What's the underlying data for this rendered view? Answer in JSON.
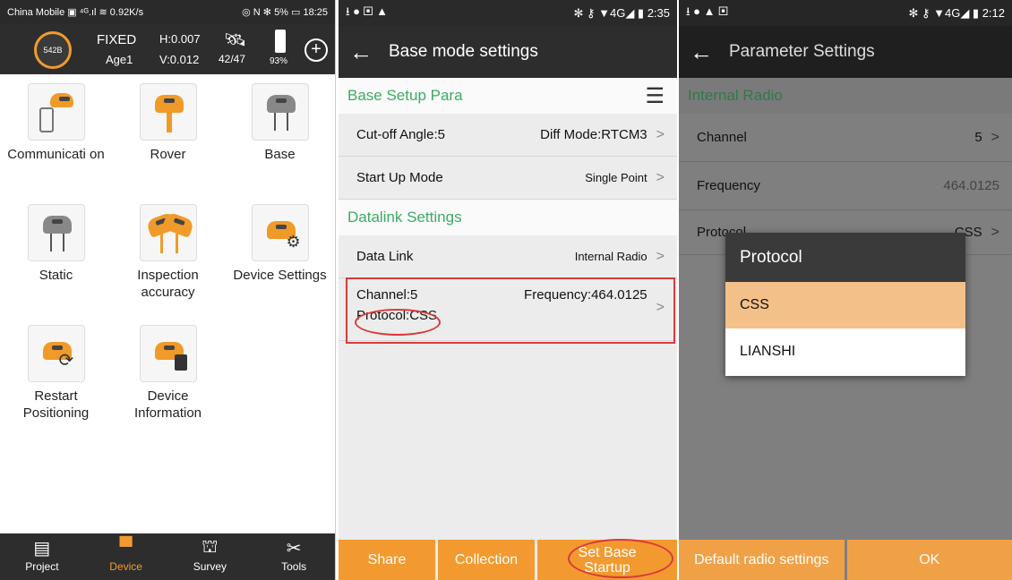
{
  "screen1": {
    "status": {
      "left": "China Mobile ▣ ⁴ᴳ.ıl ≋ 0.92K/s",
      "right": "◎ N ✻ 5% ▭ 18:25"
    },
    "header": {
      "satellites": "542B",
      "fix": "FIXED",
      "h": "H:0.007",
      "v": "V:0.012",
      "sats": "42/47",
      "age": "Age1",
      "battery": "93%",
      "add": "+"
    },
    "items": [
      "Communicati on",
      "Rover",
      "Base",
      "Static",
      "Inspection accuracy",
      "Device Settings",
      "Restart Positioning",
      "Device Information"
    ],
    "nav": [
      {
        "label": "Project",
        "icon": "▤"
      },
      {
        "label": "Device",
        "icon": "▀"
      },
      {
        "label": "Survey",
        "icon": "⛫"
      },
      {
        "label": "Tools",
        "icon": "✂"
      }
    ]
  },
  "screen2": {
    "status": {
      "left": "⭳ ● ▣ ▲",
      "right": "✻ ⚷ ▼4G◢ ▮ 2:35"
    },
    "title": "Base mode settings",
    "sec1": "Base Setup Para",
    "cutoff": "Cut-off Angle:5",
    "diff": "Diff Mode:RTCM3",
    "startup_label": "Start Up Mode",
    "startup_value": "Single Point",
    "sec2": "Datalink Settings",
    "datalink_label": "Data Link",
    "datalink_value": "Internal Radio",
    "channel": "Channel:5",
    "frequency": "Frequency:464.0125",
    "protocol": "Protocol:CSS",
    "buttons": [
      "Share",
      "Collection",
      "Set Base Startup"
    ]
  },
  "screen3": {
    "status": {
      "left": "⭳ ● ▲ ▣",
      "right": "✻ ⚷ ▼4G◢ ▮ 2:12"
    },
    "title": "Parameter Settings",
    "sec": "Internal Radio",
    "channel_label": "Channel",
    "channel_value": "5",
    "freq_label": "Frequency",
    "freq_value": "464.0125",
    "proto_label": "Protocol",
    "proto_value": "CSS",
    "dialog": {
      "title": "Protocol",
      "options": [
        "CSS",
        "LIANSHI"
      ],
      "selected": "CSS"
    },
    "buttons": [
      "Default radio settings",
      "OK"
    ]
  }
}
